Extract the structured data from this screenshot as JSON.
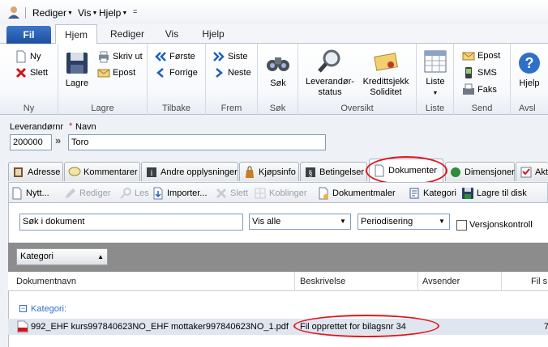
{
  "quick_access": {
    "rediger": "Rediger",
    "vis": "Vis",
    "hjelp": "Hjelp"
  },
  "ribbon_tabs": [
    "Fil",
    "Hjem",
    "Rediger",
    "Vis",
    "Hjelp"
  ],
  "ribbon": {
    "ny": "Ny",
    "slett": "Slett",
    "lagre": "Lagre",
    "skriv_ut": "Skriv ut",
    "epost": "Epost",
    "forste": "Første",
    "forrige": "Forrige",
    "siste": "Siste",
    "neste": "Neste",
    "sok": "Søk",
    "leverandorstatus_1": "Leverandør-",
    "leverandorstatus_2": "status",
    "kredittsjekk_1": "Kredittsjekk",
    "kredittsjekk_2": "Soliditet",
    "liste": "Liste",
    "epost2": "Epost",
    "sms": "SMS",
    "faks": "Faks",
    "hjelp": "Hjelp",
    "groups": {
      "ny": "Ny",
      "lagre": "Lagre",
      "tilbake": "Tilbake",
      "frem": "Frem",
      "sok": "Søk",
      "oversikt": "Oversikt",
      "liste": "Liste",
      "send": "Send",
      "avsl": "Avsl"
    }
  },
  "form": {
    "leverandornr_label": "Leverandørnr",
    "navn_label": "Navn",
    "required_mark": "*",
    "leverandornr_value": "200000",
    "navn_value": "Toro",
    "nav_arrows": "»"
  },
  "form_tabs": [
    "Adresse",
    "Kommentarer",
    "Andre opplysninger",
    "Kjøpsinfo",
    "Betingelser",
    "Dokumenter",
    "Dimensjoner",
    "Akti"
  ],
  "doc_toolbar": {
    "nytt": "Nytt...",
    "rediger": "Rediger",
    "les": "Les",
    "importer": "Importer...",
    "slett": "Slett",
    "koblinger": "Koblinger",
    "dokumentmaler": "Dokumentmaler",
    "kategori": "Kategori",
    "lagre_til_disk": "Lagre til disk"
  },
  "filters": {
    "search_value": "Søk i dokument",
    "vis_option": "Vis alle",
    "periode_option": "Periodisering",
    "versjonskontroll": "Versjonskontroll"
  },
  "grid": {
    "group_chip": "Kategori",
    "columns": [
      "Dokumentnavn",
      "Beskrivelse",
      "Avsender",
      "Fil s"
    ],
    "group_row": "Kategori:",
    "rows": [
      {
        "name": "992_EHF kurs997840623NO_EHF mottaker997840623NO_1.pdf",
        "description": "Fil opprettet for bilagsnr 34",
        "size": "7"
      }
    ]
  },
  "colors": {
    "fil_tab": "#1d4f9e",
    "highlight_ring": "#e2141b",
    "group_bar": "#8c8c8c"
  }
}
